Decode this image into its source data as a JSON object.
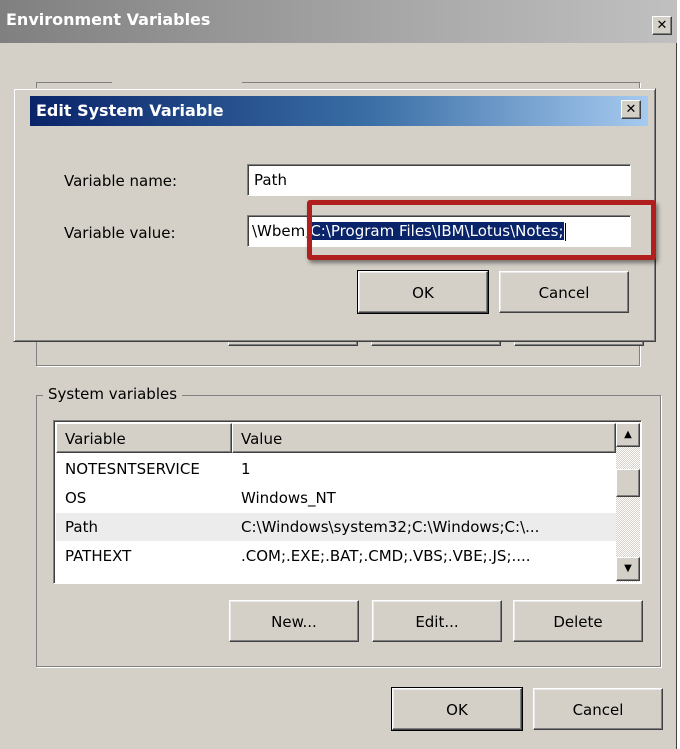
{
  "window": {
    "title": "Environment Variables",
    "close_glyph": "✕"
  },
  "dialog": {
    "title": "Edit System Variable",
    "close_glyph": "✕",
    "name_label": "Variable name:",
    "name_value": "Path",
    "value_label": "Variable value:",
    "value_prefix": "\\Wbem",
    "value_separator": ";",
    "value_selected": "C:\\Program Files\\IBM\\Lotus\\Notes;",
    "ok_label": "OK",
    "cancel_label": "Cancel",
    "highlight_color": "#b01e1e"
  },
  "system_vars": {
    "group_label": "System variables",
    "columns": [
      "Variable",
      "Value"
    ],
    "rows": [
      {
        "name": "NOTESNTSERVICE",
        "value": "1"
      },
      {
        "name": "OS",
        "value": "Windows_NT"
      },
      {
        "name": "Path",
        "value": "C:\\Windows\\system32;C:\\Windows;C:\\..."
      },
      {
        "name": "PATHEXT",
        "value": ".COM;.EXE;.BAT;.CMD;.VBS;.VBE;.JS;...."
      }
    ],
    "selected_row": "Path",
    "new_label": "New...",
    "edit_label": "Edit...",
    "delete_label": "Delete",
    "scroll_up_glyph": "▲",
    "scroll_down_glyph": "▼"
  },
  "footer": {
    "ok_label": "OK",
    "cancel_label": "Cancel"
  }
}
